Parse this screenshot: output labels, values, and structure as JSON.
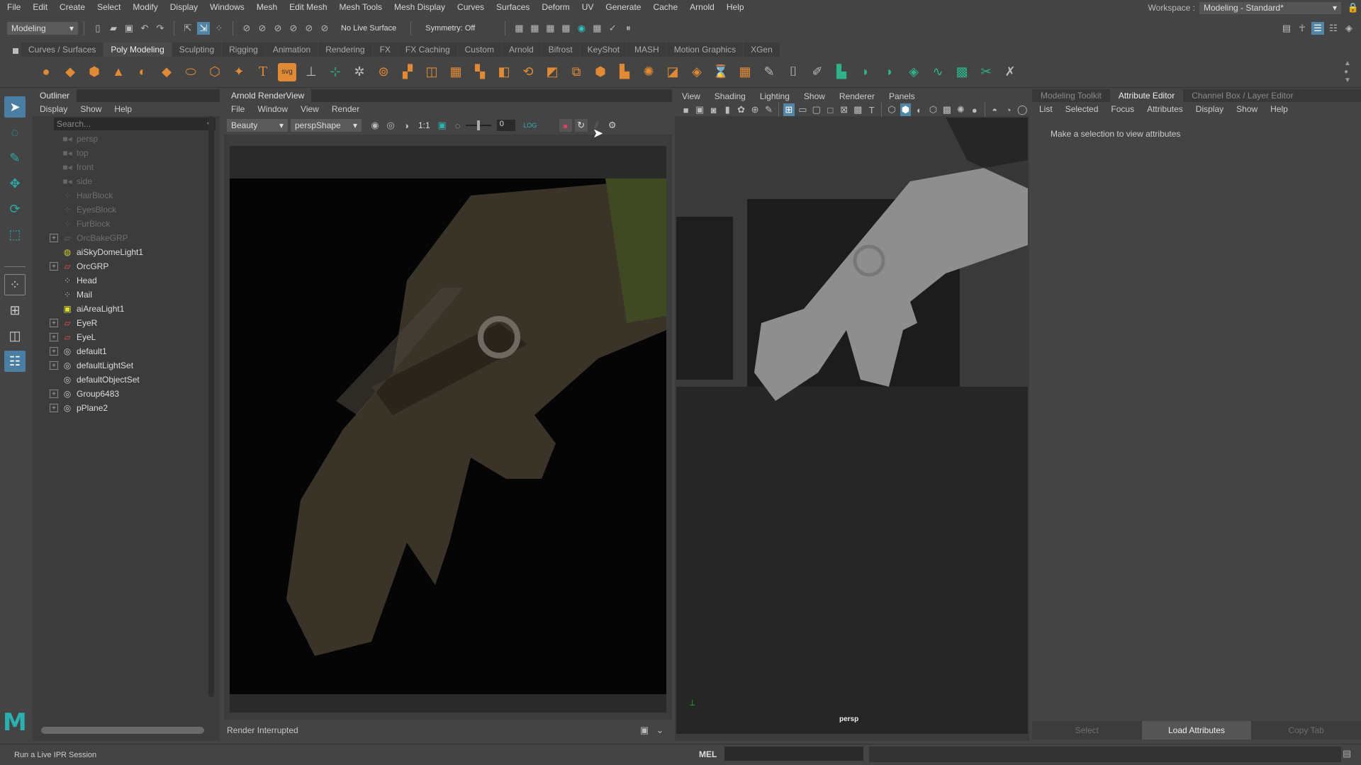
{
  "menubar": [
    "File",
    "Edit",
    "Create",
    "Select",
    "Modify",
    "Display",
    "Windows",
    "Mesh",
    "Edit Mesh",
    "Mesh Tools",
    "Mesh Display",
    "Curves",
    "Surfaces",
    "Deform",
    "UV",
    "Generate",
    "Cache",
    "Arnold",
    "Help"
  ],
  "workspace": {
    "label": "Workspace :",
    "value": "Modeling - Standard*"
  },
  "statusline": {
    "mode": "Modeling",
    "live_surface": "No Live Surface",
    "symmetry": "Symmetry: Off"
  },
  "shelf_tabs": [
    {
      "label": "Curves / Surfaces",
      "active": false
    },
    {
      "label": "Poly Modeling",
      "active": true
    },
    {
      "label": "Sculpting",
      "active": false
    },
    {
      "label": "Rigging",
      "active": false
    },
    {
      "label": "Animation",
      "active": false
    },
    {
      "label": "Rendering",
      "active": false
    },
    {
      "label": "FX",
      "active": false
    },
    {
      "label": "FX Caching",
      "active": false
    },
    {
      "label": "Custom",
      "active": false
    },
    {
      "label": "Arnold",
      "active": false
    },
    {
      "label": "Bifrost",
      "active": false
    },
    {
      "label": "KeyShot",
      "active": false
    },
    {
      "label": "MASH",
      "active": false
    },
    {
      "label": "Motion Graphics",
      "active": false
    },
    {
      "label": "XGen",
      "active": false
    }
  ],
  "outliner": {
    "title": "Outliner",
    "menu": [
      "Display",
      "Show",
      "Help"
    ],
    "search_placeholder": "Search...",
    "items": [
      {
        "name": "persp",
        "icon": "camera",
        "expandable": false,
        "dim": true
      },
      {
        "name": "top",
        "icon": "camera",
        "expandable": false,
        "dim": true
      },
      {
        "name": "front",
        "icon": "camera",
        "expandable": false,
        "dim": true
      },
      {
        "name": "side",
        "icon": "camera",
        "expandable": false,
        "dim": true
      },
      {
        "name": "HairBlock",
        "icon": "mesh",
        "expandable": false,
        "dim": true
      },
      {
        "name": "EyesBlock",
        "icon": "mesh",
        "expandable": false,
        "dim": true
      },
      {
        "name": "FurBlock",
        "icon": "mesh",
        "expandable": false,
        "dim": true
      },
      {
        "name": "OrcBakeGRP",
        "icon": "group",
        "expandable": true,
        "dim": true
      },
      {
        "name": "aiSkyDomeLight1",
        "icon": "skydome",
        "expandable": false,
        "dim": false
      },
      {
        "name": "OrcGRP",
        "icon": "group",
        "expandable": true,
        "dim": false
      },
      {
        "name": "Head",
        "icon": "mesh",
        "expandable": false,
        "dim": false
      },
      {
        "name": "Mail",
        "icon": "mesh",
        "expandable": false,
        "dim": false
      },
      {
        "name": "aiAreaLight1",
        "icon": "arealight",
        "expandable": false,
        "dim": false
      },
      {
        "name": "EyeR",
        "icon": "group",
        "expandable": true,
        "dim": false
      },
      {
        "name": "EyeL",
        "icon": "group",
        "expandable": true,
        "dim": false
      },
      {
        "name": "default1",
        "icon": "set",
        "expandable": true,
        "dim": false
      },
      {
        "name": "defaultLightSet",
        "icon": "set",
        "expandable": true,
        "dim": false
      },
      {
        "name": "defaultObjectSet",
        "icon": "set",
        "expandable": false,
        "dim": false
      },
      {
        "name": "Group6483",
        "icon": "set",
        "expandable": true,
        "dim": false
      },
      {
        "name": "pPlane2",
        "icon": "set",
        "expandable": true,
        "dim": false
      }
    ]
  },
  "renderview": {
    "title": "Arnold RenderView",
    "menu": [
      "File",
      "Window",
      "View",
      "Render"
    ],
    "aov": "Beauty",
    "camera": "perspShape",
    "ratio": "1:1",
    "exposure": "0",
    "log_label": "LOG",
    "status": "Render Interrupted"
  },
  "viewport": {
    "menu": [
      "View",
      "Shading",
      "Lighting",
      "Show",
      "Renderer",
      "Panels"
    ],
    "camera_label": "persp"
  },
  "attribute_editor": {
    "tabs": [
      {
        "label": "Modeling Toolkit",
        "active": false
      },
      {
        "label": "Attribute Editor",
        "active": true
      },
      {
        "label": "Channel Box / Layer Editor",
        "active": false
      }
    ],
    "menu": [
      "List",
      "Selected",
      "Focus",
      "Attributes",
      "Display",
      "Show",
      "Help"
    ],
    "message": "Make a selection to view attributes",
    "buttons": [
      {
        "label": "Select",
        "active": false
      },
      {
        "label": "Load Attributes",
        "active": true
      },
      {
        "label": "Copy Tab",
        "active": false
      }
    ]
  },
  "helpline": {
    "text": "Run a Live IPR Session"
  },
  "commandline": {
    "language": "MEL"
  },
  "colors": {
    "accent": "#4a7fa3",
    "shelf_orange": "#e08a35",
    "shelf_green": "#2fb28a",
    "maya_teal": "#2bb0b0"
  }
}
